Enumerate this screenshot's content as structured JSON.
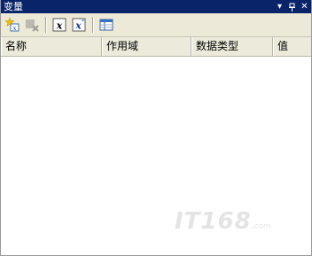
{
  "window": {
    "title": "变量",
    "controls": [
      "▾",
      "ꟹ",
      "✕"
    ]
  },
  "toolbar": {
    "items": [
      {
        "name": "add-variable",
        "icon": "add-variable-icon",
        "enabled": true
      },
      {
        "name": "delete-variable",
        "icon": "delete-variable-icon",
        "enabled": false
      },
      {
        "name": "show-system-variables",
        "icon": "x-variable-icon",
        "enabled": true
      },
      {
        "name": "show-all-variables",
        "icon": "x-variable-alt-icon",
        "enabled": true
      },
      {
        "name": "choose-columns",
        "icon": "columns-icon",
        "enabled": true
      }
    ]
  },
  "table": {
    "columns": [
      "名称",
      "作用域",
      "数据类型",
      "值"
    ],
    "rows": []
  },
  "watermark": {
    "text": "IT168",
    "suffix": ".com"
  }
}
